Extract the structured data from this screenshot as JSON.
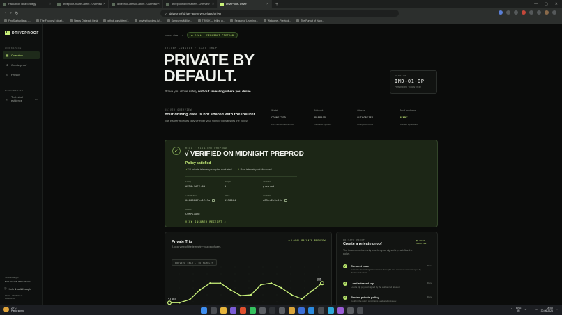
{
  "browser": {
    "tabs": [
      {
        "title": "Hackathon Idea Strategy",
        "active": false
      },
      {
        "title": "driveproof-insurer-attem - Overview",
        "active": false
      },
      {
        "title": "driveproof-attestor-attem - Overview",
        "active": false
      },
      {
        "title": "driveproof-driver-attem - Overview",
        "active": false
      },
      {
        "title": "DriveProof - Driver",
        "active": true
      }
    ],
    "new_tab": "+",
    "url": "driveproof-driver-attem.vercel.app/driver",
    "bookmarks": [
      "FindStartupIdeas -...",
      "The Foundry | Idea t...",
      "Nexus Outreach Desk",
      "github.com/attem/...",
      "onlythefounders.io/...",
      "Sampurnn/Million...",
      "TRUCK — telling w...",
      "Season of Learning...",
      "Welcome - Freetool...",
      "The Pursuit of Happ..."
    ]
  },
  "sidebar": {
    "brand": "DRIVEPROOF",
    "brand_mark": "D",
    "section_workspace": "WORKSPACE",
    "items": [
      {
        "label": "Overview",
        "icon": "grid",
        "active": true
      },
      {
        "label": "Create proof",
        "icon": "plus",
        "active": false
      },
      {
        "label": "Privacy",
        "icon": "lock",
        "active": false
      }
    ],
    "section_engineering": "ENGINEERING",
    "technical": {
      "label": "Technical evidence",
      "tag": "ZK"
    },
    "network_target_label": "Network target",
    "network_target_value": "MIDNIGHT PREPROD",
    "help": "Help & walkthrough",
    "foot_mode": "REAL · MIDNIGHT PREPROD"
  },
  "main": {
    "crumb_insurer": "Insurer view",
    "crumb_arrow": "↗",
    "crumb_pill": "● REAL · MIDNIGHT PREPROD",
    "eyebrow": "DRIVER CONSOLE · SAFE TRIP",
    "hero_line1": "PRIVATE BY",
    "hero_line2": "DEFAULT.",
    "hero_sub_a": "Prove you drove safely ",
    "hero_sub_b": "without revealing where you drove.",
    "vehicle": {
      "label": "VEHICLE",
      "id": "IND-01-DP",
      "sub": "Personal trip · Today 09:42"
    },
    "overview": {
      "title": "DRIVER OVERVIEW",
      "heading": "Your driving data is not shared with the insurer.",
      "desc": "The insurer receives only whether your signed trip satisfies the policy."
    },
    "status": [
      {
        "label": "Wallet",
        "value": "CONNECTED",
        "detail": "Lace account authorized",
        "ok": false
      },
      {
        "label": "Network",
        "value": "PREPROD",
        "detail": "Validated by client",
        "ok": false
      },
      {
        "label": "Attestor",
        "value": "AUTHORIZED",
        "detail": "Configured issuer",
        "ok": false
      },
      {
        "label": "Proof readiness",
        "value": "READY",
        "detail": "Attested trip loaded",
        "ok": true
      }
    ]
  },
  "verified": {
    "label": "REAL · MIDNIGHT PREPROD",
    "title": "√ VERIFIED ON MIDNIGHT PREPROD",
    "policy": "Policy satisfied",
    "checks": [
      "16 private telemetry samples evaluated",
      "Raw telemetry not disclosed"
    ],
    "fields": [
      {
        "k": "Policy",
        "v": "AUTO-SAFE-01",
        "copy": false
      },
      {
        "k": "Subject",
        "v": "1",
        "copy": false
      },
      {
        "k": "Network",
        "v": "preprod",
        "copy": false
      },
      {
        "k": "Transaction",
        "v": "00006807…c1f49a",
        "copy": true
      },
      {
        "k": "Block",
        "v": "1338004",
        "copy": false
      },
      {
        "k": "Contract",
        "v": "a85cd2…3c20d",
        "copy": true
      },
      {
        "k": "Result",
        "v": "COMPLIANT",
        "copy": false
      }
    ],
    "link": "VIEW INSURER RECEIPT ↗"
  },
  "trip": {
    "title": "Private Trip",
    "desc": "A local view of the telemetry your proof uses.",
    "badge": "● LOCAL PRIVATE PREVIEW",
    "chip": "PREVIEW ONLY · 16 SAMPLES",
    "start": "START",
    "end": "END",
    "samples": [
      0.12,
      0.12,
      0.2,
      0.45,
      0.62,
      0.62,
      0.45,
      0.3,
      0.32,
      0.58,
      0.62,
      0.5,
      0.32,
      0.22,
      0.42,
      0.62
    ]
  },
  "create": {
    "label": "PRIVATE PROOF",
    "title": "Create a private proof",
    "desc": "The insurer receives only whether your signed trip satisfies the policy.",
    "badge": "● AUTO-SAFE-01",
    "steps": [
      {
        "name": "Connect Lace",
        "status": "Done",
        "desc": "Authorize the Midnight transaction through Lace. Connection is managed by the injected client."
      },
      {
        "name": "Load attested trip",
        "status": "Done",
        "desc": "Load a trip payload signed by the authorized attestor."
      },
      {
        "name": "Review private policy",
        "status": "Done",
        "desc": "Confirm the policy constraints evaluated privately."
      }
    ]
  },
  "taskbar": {
    "temp": "28°C",
    "weather": "Partly sunny",
    "lang": "ENG",
    "region": "IN",
    "time": "00:00",
    "date": "30-06-2026"
  },
  "colors": {
    "accent": "#c9f17a",
    "card": "#1c2616",
    "bg": "#0b0c0b"
  }
}
